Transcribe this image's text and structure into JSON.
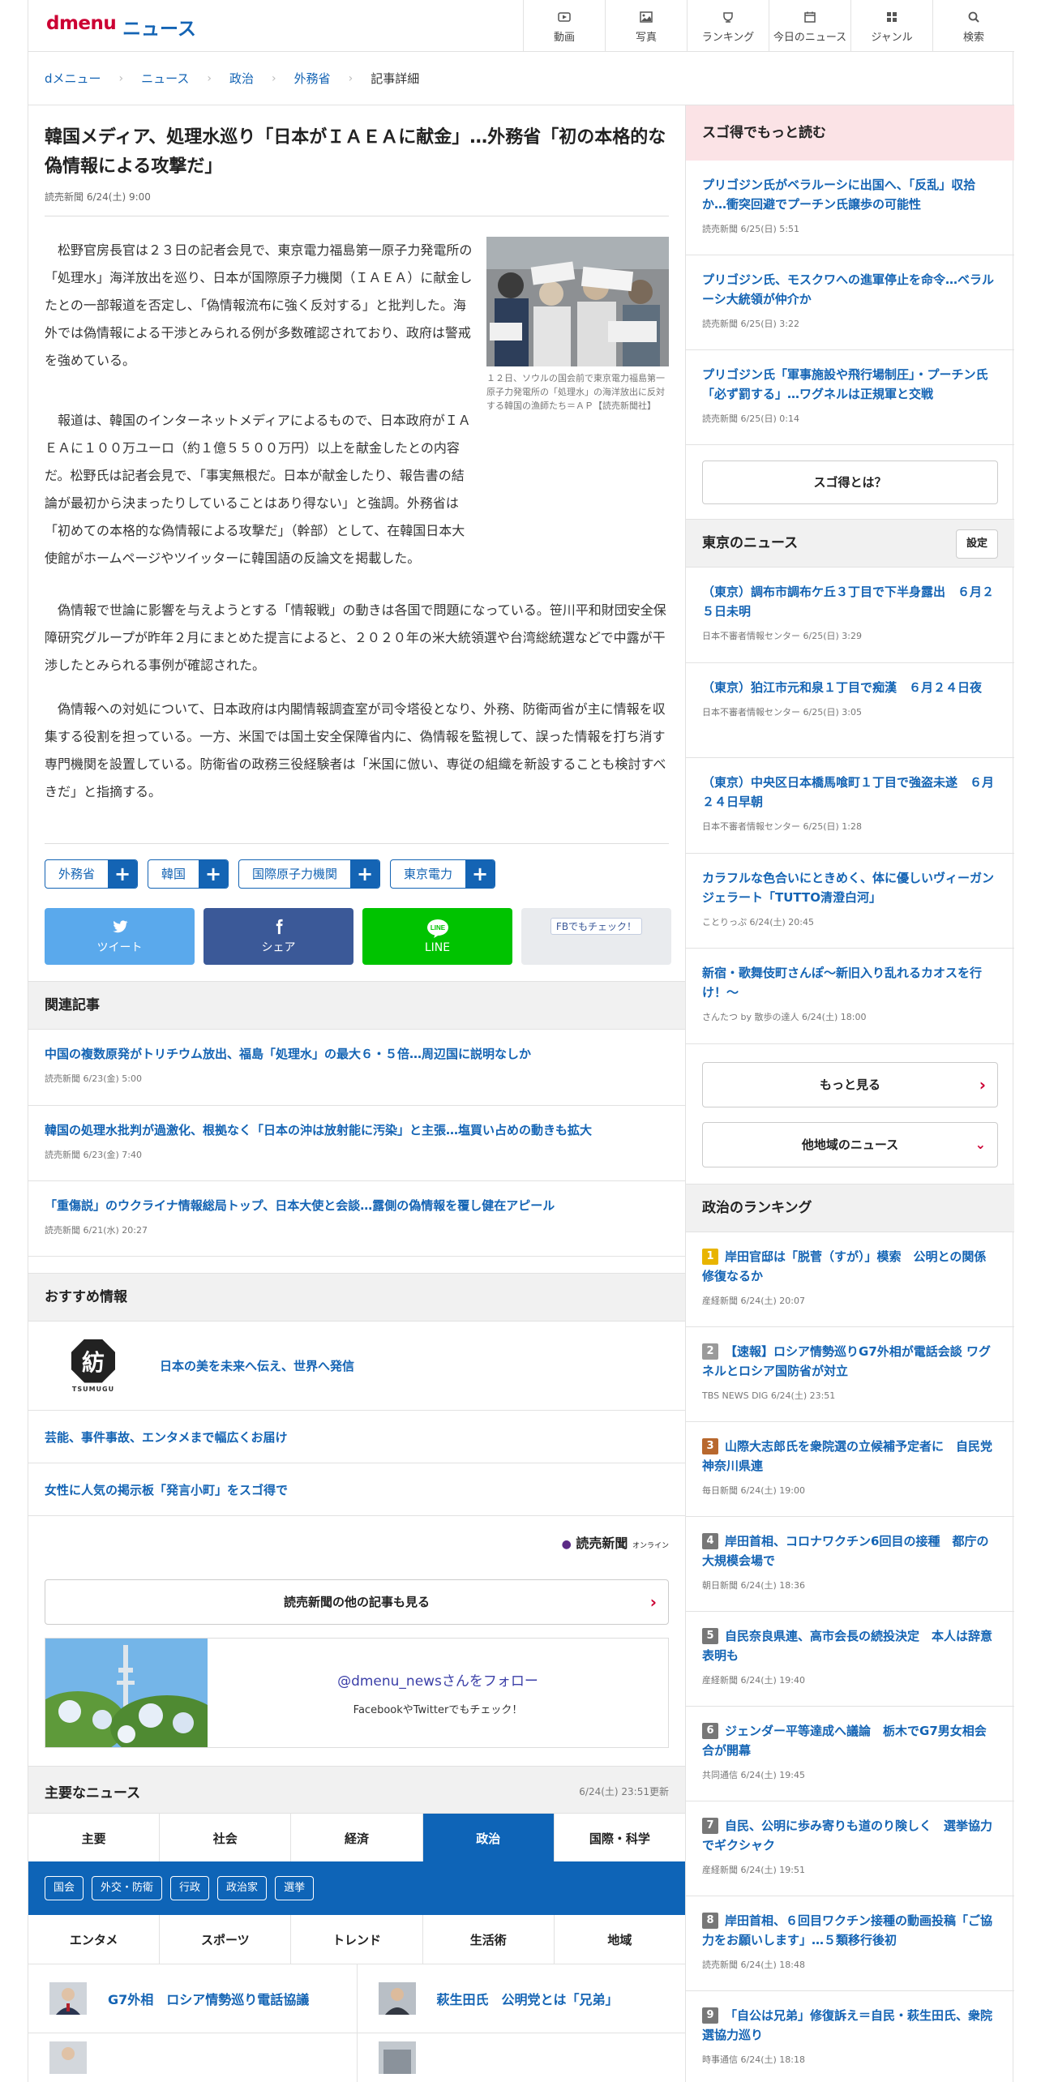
{
  "header": {
    "logo": "dmenu",
    "site_title": "ニュース",
    "nav": [
      {
        "icon": "video-icon",
        "label": "動画"
      },
      {
        "icon": "photo-icon",
        "label": "写真"
      },
      {
        "icon": "ranking-icon",
        "label": "ランキング"
      },
      {
        "icon": "today-icon",
        "label": "今日のニュース"
      },
      {
        "icon": "genre-icon",
        "label": "ジャンル"
      },
      {
        "icon": "search-icon",
        "label": "検索"
      }
    ]
  },
  "breadcrumb": [
    "dメニュー",
    "ニュース",
    "政治",
    "外務省",
    "記事詳細"
  ],
  "article": {
    "title": "韓国メディア、処理水巡り「日本がＩＡＥＡに献金」…外務省「初の本格的な偽情報による攻撃だ」",
    "meta": "読売新聞 6/24(土) 9:00",
    "photo_caption": "１２日、ソウルの国会前で東京電力福島第一原子力発電所の「処理水」の海洋放出に反対する韓国の漁師たち＝ＡＰ【読売新聞社】",
    "paragraphs": [
      "松野官房長官は２３日の記者会見で、東京電力福島第一原子力発電所の「処理水」海洋放出を巡り、日本が国際原子力機関（ＩＡＥＡ）に献金したとの一部報道を否定し、「偽情報流布に強く反対する」と批判した。海外では偽情報による干渉とみられる例が多数確認されており、政府は警戒を強めている。",
      "報道は、韓国のインターネットメディアによるもので、日本政府がＩＡＥＡに１００万ユーロ（約１億５５００万円）以上を献金したとの内容だ。松野氏は記者会見で、「事実無根だ。日本が献金したり、報告書の結論が最初から決まったりしていることはあり得ない」と強調。外務省は「初めての本格的な偽情報による攻撃だ」（幹部）として、在韓国日本大使館がホームページやツイッターに韓国語の反論文を掲載した。",
      "偽情報で世論に影響を与えようとする「情報戦」の動きは各国で問題になっている。笹川平和財団安全保障研究グループが昨年２月にまとめた提言によると、２０２０年の米大統領選や台湾総統選などで中露が干渉したとみられる事例が確認された。",
      "偽情報への対処について、日本政府は内閣情報調査室が司令塔役となり、外務、防衛両省が主に情報を収集する役割を担っている。一方、米国では国土安全保障省内に、偽情報を監視して、誤った情報を打ち消す専門機関を設置している。防衛省の政務三役経験者は「米国に倣い、専従の組織を新設することも検討すべきだ」と指摘する。"
    ],
    "tags": [
      "外務省",
      "韓国",
      "国際原子力機関",
      "東京電力"
    ],
    "share": [
      {
        "icon": "twitter-icon",
        "label": "ツイート",
        "color": "#5aa9ec"
      },
      {
        "icon": "facebook-icon",
        "label": "シェア",
        "color": "#3b5998"
      },
      {
        "icon": "line-icon",
        "label": "LINE",
        "color": "#00c300"
      },
      {
        "icon": "facebook-check-icon",
        "label": "FBでもチェック！",
        "color": "#e9ebee"
      }
    ]
  },
  "related": {
    "heading": "関連記事",
    "items": [
      {
        "title": "中国の複数原発がトリチウム放出、福島「処理水」の最大６・５倍…周辺国に説明なしか",
        "meta": "読売新聞 6/23(金) 5:00"
      },
      {
        "title": "韓国の処理水批判が過激化、根拠なく「日本の沖は放射能に汚染」と主張…塩買い占めの動きも拡大",
        "meta": "読売新聞 6/23(金) 7:40"
      },
      {
        "title": "「重傷説」のウクライナ情報総局トップ、日本大使と会談…露側の偽情報を覆し健在アピール",
        "meta": "読売新聞 6/21(水) 20:27"
      }
    ]
  },
  "recommend": {
    "heading": "おすすめ情報",
    "tsumugu_logo": "TSUMUGU",
    "items": [
      "日本の美を未来へ伝え、世界へ発信",
      "芸能、事件事故、エンタメまで幅広くお届け",
      "女性に人気の掲示板「発言小町」をスゴ得で"
    ]
  },
  "yomiuri": {
    "logo": "読売新聞",
    "logo_sub": "オンライン",
    "more": "読売新聞の他の記事も見る"
  },
  "follow": {
    "heading": "@dmenu_newsさんをフォロー",
    "sub": "FacebookやTwitterでもチェック！"
  },
  "main_news": {
    "heading": "主要なニュース",
    "updated": "6/24(土) 23:51更新",
    "tabs_row1": [
      "主要",
      "社会",
      "経済",
      "政治",
      "国際・科学"
    ],
    "active_tab": "政治",
    "subtabs": [
      "国会",
      "外交・防衛",
      "行政",
      "政治家",
      "選挙"
    ],
    "tabs_row2": [
      "エンタメ",
      "スポーツ",
      "トレンド",
      "生活術",
      "地域"
    ],
    "items": [
      "G7外相　ロシア情勢巡り電話協議",
      "萩生田氏　公明党とは「兄弟」"
    ]
  },
  "sidebar": {
    "sugotoku": {
      "heading": "スゴ得でもっと読む",
      "items": [
        {
          "title": "プリゴジン氏がベラルーシに出国へ、「反乱」収拾か…衝突回避でプーチン氏譲歩の可能性",
          "meta": "読売新聞 6/25(日) 5:51"
        },
        {
          "title": "プリゴジン氏、モスクワへの進軍停止を命令…ベラルーシ大統領が仲介か",
          "meta": "読売新聞 6/25(日) 3:22"
        },
        {
          "title": "プリゴジン氏「軍事施設や飛行場制圧」・プーチン氏「必ず罰する」…ワグネルは正規軍と交戦",
          "meta": "読売新聞 6/25(日) 0:14"
        }
      ],
      "what": "スゴ得とは？"
    },
    "tokyo": {
      "heading": "東京のニュース",
      "settings": "設定",
      "items": [
        {
          "title": "（東京）調布市調布ケ丘３丁目で下半身露出　６月２５日未明",
          "meta": "日本不審者情報センター 6/25(日) 3:29"
        },
        {
          "title": "（東京）狛江市元和泉１丁目で痴漢　６月２４日夜",
          "meta": "日本不審者情報センター 6/25(日) 3:05"
        },
        {
          "title": "（東京）中央区日本橋馬喰町１丁目で強盗未遂　６月２４日早朝",
          "meta": "日本不審者情報センター 6/25(日) 1:28"
        },
        {
          "title": "カラフルな色合いにときめく、体に優しいヴィーガンジェラート「TUTTO清澄白河」",
          "meta": "ことりっぷ 6/24(土) 20:45"
        },
        {
          "title": "新宿・歌舞伎町さんぽ～新旧入り乱れるカオスを行け！～",
          "meta": "さんたつ by 散歩の達人 6/24(土) 18:00"
        }
      ],
      "more": "もっと見る",
      "other": "他地域のニュース"
    },
    "ranking": {
      "heading": "政治のランキング",
      "items": [
        {
          "rank": "1",
          "color": "#e8b400",
          "title": "岸田官邸は「脱菅（すが）」模索　公明との関係修復なるか",
          "meta": "産経新聞 6/24(土) 20:07"
        },
        {
          "rank": "2",
          "color": "#9a9a9a",
          "title": "【速報】ロシア情勢巡りG7外相が電話会談 ワグネルとロシア国防省が対立",
          "meta": "TBS NEWS DIG 6/24(土) 23:51"
        },
        {
          "rank": "3",
          "color": "#b8682e",
          "title": "山際大志郎氏を衆院選の立候補予定者に　自民党神奈川県連",
          "meta": "毎日新聞 6/24(土) 19:00"
        },
        {
          "rank": "4",
          "color": "#777777",
          "title": "岸田首相、コロナワクチン6回目の接種　都庁の大規模会場で",
          "meta": "朝日新聞 6/24(土) 18:36"
        },
        {
          "rank": "5",
          "color": "#777777",
          "title": "自民奈良県連、高市会長の続投決定　本人は辞意表明も",
          "meta": "産経新聞 6/24(土) 19:40"
        },
        {
          "rank": "6",
          "color": "#777777",
          "title": "ジェンダー平等達成へ議論　栃木でG7男女相会合が開幕",
          "meta": "共同通信 6/24(土) 19:45"
        },
        {
          "rank": "7",
          "color": "#777777",
          "title": "自民、公明に歩み寄りも道のり険しく　選挙協力でギクシャク",
          "meta": "産経新聞 6/24(土) 19:51"
        },
        {
          "rank": "8",
          "color": "#777777",
          "title": "岸田首相、６回目ワクチン接種の動画投稿「ご協力をお願いします」…５類移行後初",
          "meta": "読売新聞 6/24(土) 18:48"
        },
        {
          "rank": "9",
          "color": "#777777",
          "title": "「自公は兄弟」修復訴え＝自民・萩生田氏、衆院選協力巡り",
          "meta": "時事通信 6/24(土) 18:18"
        }
      ]
    }
  }
}
